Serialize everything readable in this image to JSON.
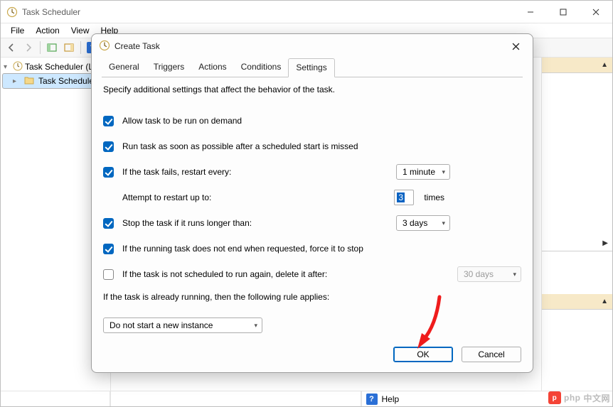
{
  "main": {
    "title": "Task Scheduler",
    "menu": {
      "file": "File",
      "action": "Action",
      "view": "View",
      "help": "Help"
    },
    "tree": {
      "root": "Task Scheduler (L",
      "child": "Task Schedule"
    },
    "status": {
      "help_label": "Help"
    }
  },
  "dialog": {
    "title": "Create Task",
    "tabs": {
      "general": "General",
      "triggers": "Triggers",
      "actions": "Actions",
      "conditions": "Conditions",
      "settings": "Settings"
    },
    "intro": "Specify additional settings that affect the behavior of the task.",
    "settings": {
      "allow_on_demand": "Allow task to be run on demand",
      "run_asap": "Run task as soon as possible after a scheduled start is missed",
      "restart_label": "If the task fails, restart every:",
      "restart_interval": "1 minute",
      "attempt_label": "Attempt to restart up to:",
      "attempt_value": "3",
      "attempt_suffix": "times",
      "stop_longer_label": "Stop the task if it runs longer than:",
      "stop_longer_value": "3 days",
      "force_stop": "If the running task does not end when requested, force it to stop",
      "delete_after_label": "If the task is not scheduled to run again, delete it after:",
      "delete_after_value": "30 days",
      "rule_intro": "If the task is already running, then the following rule applies:",
      "rule_value": "Do not start a new instance"
    },
    "buttons": {
      "ok": "OK",
      "cancel": "Cancel"
    }
  },
  "watermark": {
    "text": "中文网",
    "prefix": "php"
  }
}
